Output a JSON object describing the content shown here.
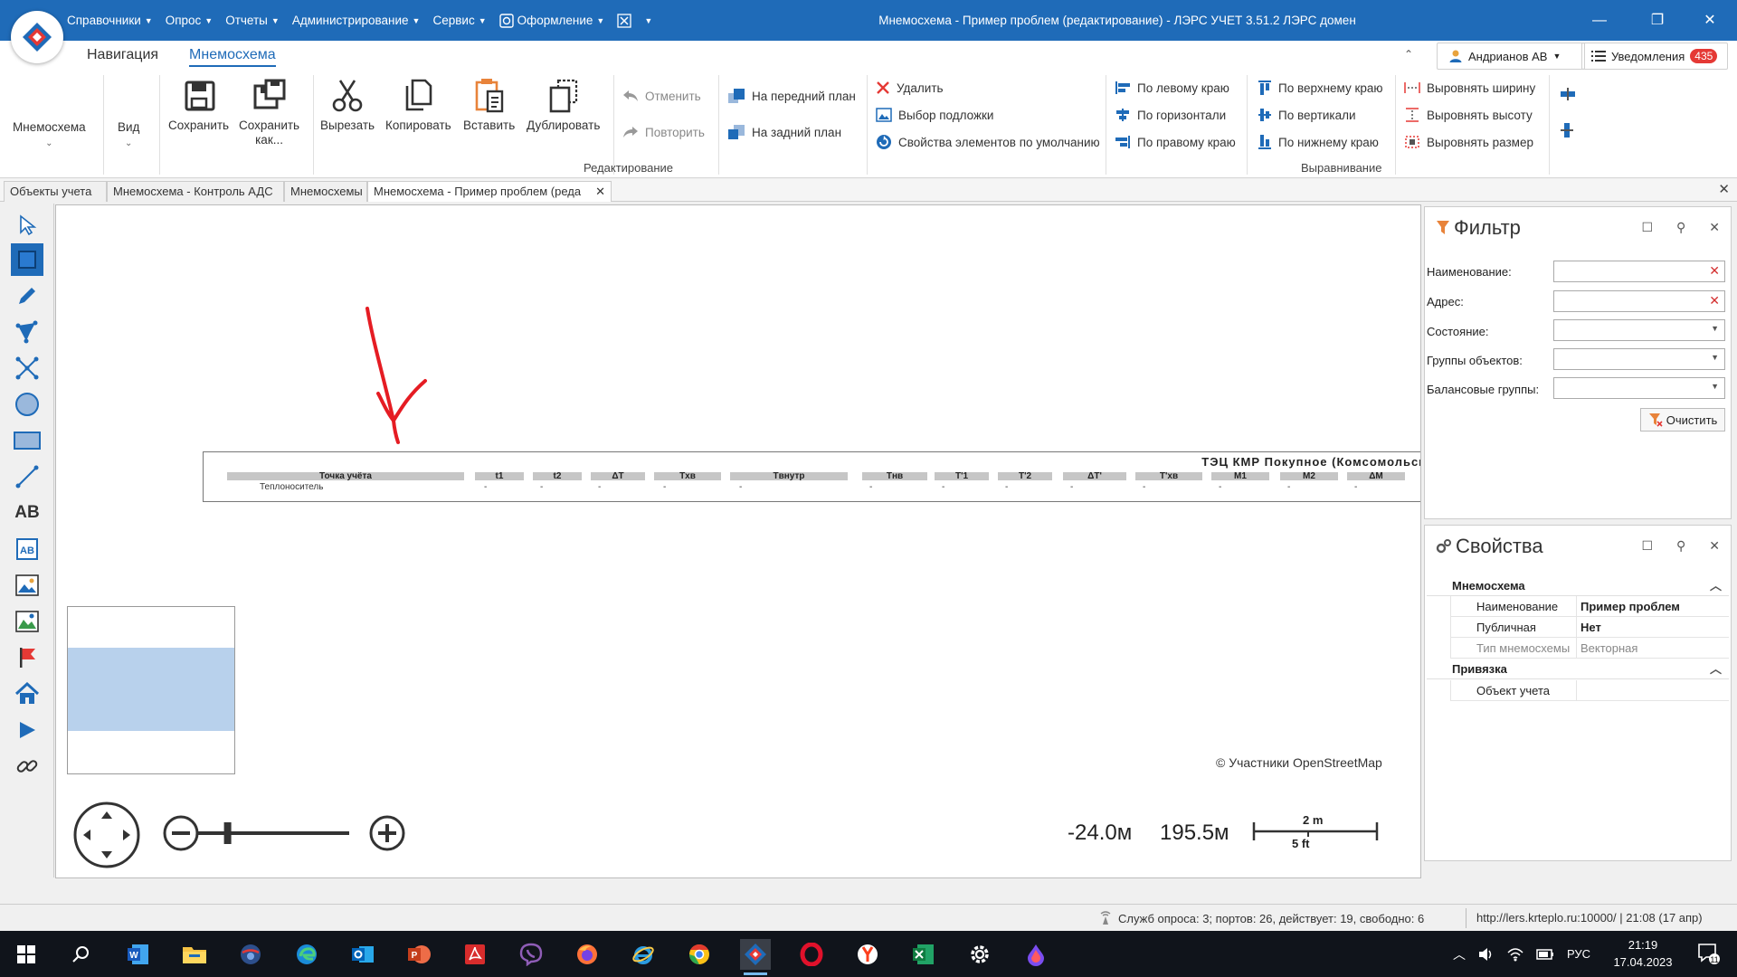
{
  "titlebar": {
    "menu": [
      {
        "label": "Справочники",
        "chevron": true
      },
      {
        "label": "Опрос",
        "chevron": true
      },
      {
        "label": "Отчеты",
        "chevron": true
      },
      {
        "label": "Администрирование",
        "chevron": true
      },
      {
        "label": "Сервис",
        "chevron": true
      },
      {
        "label": "Оформление",
        "chevron": true
      }
    ],
    "window_title": "Мнемосхема - Пример проблем (редактирование) - ЛЭРС УЧЕТ 3.51.2 ЛЭРС домен",
    "min": "—",
    "restore": "❐",
    "close": "✕"
  },
  "ribbon": {
    "tabs": [
      {
        "label": "Навигация",
        "active": false
      },
      {
        "label": "Мнемосхема",
        "active": true
      }
    ],
    "collapse": "⌃",
    "user": "Андрианов АВ",
    "notifications_label": "Уведомления",
    "notifications_count": "435",
    "mnemo_btn": "Мнемосхема",
    "view_btn": "Вид",
    "save": "Сохранить",
    "save_as_1": "Сохранить",
    "save_as_2": "как...",
    "cut": "Вырезать",
    "copy": "Копировать",
    "paste": "Вставить",
    "duplicate": "Дублировать",
    "undo": "Отменить",
    "redo": "Повторить",
    "to_front": "На передний план",
    "to_back": "На задний план",
    "delete": "Удалить",
    "choose_backing": "Выбор подложки",
    "default_props": "Свойства элементов по умолчанию",
    "group_edit": "Редактирование",
    "align_left": "По левому краю",
    "align_hcenter": "По горизонтали",
    "align_right": "По правому краю",
    "align_top": "По верхнему краю",
    "align_vcenter": "По вертикали",
    "align_bottom": "По нижнему краю",
    "same_width": "Выровнять ширину",
    "same_height": "Выровнять высоту",
    "same_size": "Выровнять размер",
    "group_align": "Выравнивание"
  },
  "doc_tabs": [
    {
      "label": "Объекты учета",
      "active": false
    },
    {
      "label": "Мнемосхема - Контроль АДС",
      "active": false
    },
    {
      "label": "Мнемосхемы",
      "active": false
    },
    {
      "label": "Мнемосхема - Пример проблем (реда",
      "active": true
    }
  ],
  "canvas": {
    "table_title": "ТЭЦ КМР Покупное (Комсомольский)",
    "headers": [
      "Точка учёта",
      "t1",
      "t2",
      "ΔT",
      "Txв",
      "Tвнутр",
      "Tнв",
      "T'1",
      "T'2",
      "ΔT'",
      "T'xв",
      "M1",
      "M2",
      "ΔM"
    ],
    "row_label": "Теплоноситель",
    "row_values": [
      "-",
      "-",
      "-",
      "-",
      "-",
      "-",
      "-",
      "-",
      "-",
      "-",
      "-",
      "-",
      "-"
    ],
    "osm_credit": "© Участники OpenStreetMap",
    "coord_x": "-24.0м",
    "coord_y": "195.5м",
    "scale_m": "2 m",
    "scale_ft": "5 ft",
    "zoom_level": 0.2
  },
  "filter": {
    "title": "Фильтр",
    "fields": [
      {
        "label": "Наименование:",
        "type": "text",
        "value": ""
      },
      {
        "label": "Адрес:",
        "type": "text",
        "value": ""
      },
      {
        "label": "Состояние:",
        "type": "select",
        "value": ""
      },
      {
        "label": "Группы объектов:",
        "type": "select",
        "value": ""
      },
      {
        "label": "Балансовые группы:",
        "type": "select",
        "value": ""
      }
    ],
    "clear_btn": "Очистить"
  },
  "properties": {
    "title": "Свойства",
    "section_mnemo": "Мнемосхема",
    "name_key": "Наименование",
    "name_val": "Пример проблем",
    "public_key": "Публичная",
    "public_val": "Нет",
    "type_key": "Тип мнемосхемы",
    "type_val": "Векторная",
    "section_bind": "Привязка",
    "object_key": "Объект учета",
    "object_val": ""
  },
  "status": {
    "services": "Служб опроса: 3; портов: 26, действует: 19, свободно: 6",
    "url_time": "http://lers.krteplo.ru:10000/ | 21:08 (17 апр)"
  },
  "taskbar": {
    "lang": "РУС",
    "time": "21:19",
    "date": "17.04.2023",
    "notif_count": "11"
  },
  "colors": {
    "accent": "#1f6bb8",
    "badge": "#e53935",
    "arrow": "#e51c23"
  }
}
